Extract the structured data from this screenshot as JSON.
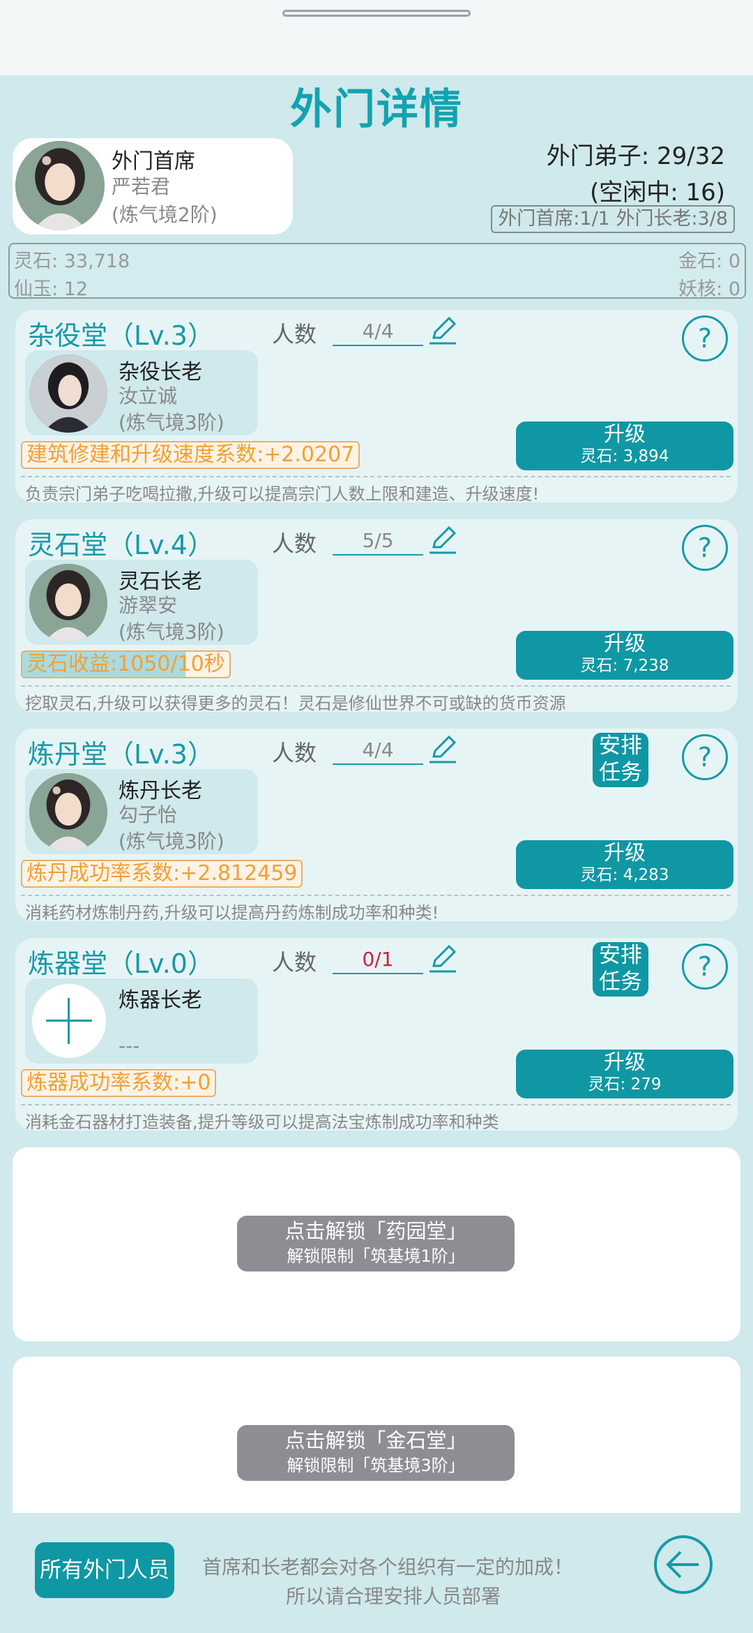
{
  "page": {
    "title": "外门详情"
  },
  "head": {
    "title": "外门首席",
    "name": "严若君",
    "rank": "(炼气境2阶)"
  },
  "stats": {
    "disciples": "外门弟子: 29/32",
    "idle": "(空闲中: 16)",
    "roles": "外门首席:1/1 外门长老:3/8"
  },
  "resources": {
    "spirit_stone": "灵石: 33,718",
    "gold_stone": "金石: 0",
    "jade": "仙玉: 12",
    "demon_core": "妖核: 0"
  },
  "halls": [
    {
      "name": "杂役堂（Lv.3）",
      "count_label": "人数",
      "count": "4/4",
      "elder_title": "杂役长老",
      "elder_name": "汝立诚",
      "elder_rank": "(炼气境3阶)",
      "bonus": "建筑修建和升级速度系数:+2.0207",
      "upgrade": "升级",
      "upgrade_cost": "灵石: 3,894",
      "desc": "负责宗门弟子吃喝拉撒,升级可以提高宗门人数上限和建造、升级速度!",
      "has_task": false
    },
    {
      "name": "灵石堂（Lv.4）",
      "count_label": "人数",
      "count": "5/5",
      "elder_title": "灵石长老",
      "elder_name": "游翠安",
      "elder_rank": "(炼气境3阶)",
      "bonus": "灵石收益:1050/10秒",
      "bonus_progress": 0.8,
      "upgrade": "升级",
      "upgrade_cost": "灵石: 7,238",
      "desc": "挖取灵石,升级可以获得更多的灵石！灵石是修仙世界不可或缺的货币资源",
      "has_task": false
    },
    {
      "name": "炼丹堂（Lv.3）",
      "count_label": "人数",
      "count": "4/4",
      "elder_title": "炼丹长老",
      "elder_name": "勾子怡",
      "elder_rank": "(炼气境3阶)",
      "bonus": "炼丹成功率系数:+2.812459",
      "upgrade": "升级",
      "upgrade_cost": "灵石: 4,283",
      "desc": "消耗药材炼制丹药,升级可以提高丹药炼制成功率和种类!",
      "has_task": true,
      "task_label": "安排任务"
    },
    {
      "name": "炼器堂（Lv.0）",
      "count_label": "人数",
      "count": "0/1",
      "elder_title": "炼器长老",
      "elder_name": "---",
      "elder_rank": "",
      "bonus": "炼器成功率系数:+0",
      "upgrade": "升级",
      "upgrade_cost": "灵石: 279",
      "desc": "消耗金石器材打造装备,提升等级可以提高法宝炼制成功率和种类",
      "has_task": true,
      "task_label": "安排任务"
    }
  ],
  "locked": [
    {
      "line1": "点击解锁「药园堂」",
      "line2": "解锁限制「筑基境1阶」"
    },
    {
      "line1": "点击解锁「金石堂」",
      "line2": "解锁限制「筑基境3阶」"
    }
  ],
  "bottom": {
    "all_members": "所有外门人员",
    "tip1": "首席和长老都会对各个组织有一定的加成！",
    "tip2": "所以请合理安排人员部署"
  },
  "colors": {
    "accent": "#169aa7",
    "button": "#0f97a4",
    "bonus": "#f3a033",
    "locked": "#8c8e93"
  }
}
